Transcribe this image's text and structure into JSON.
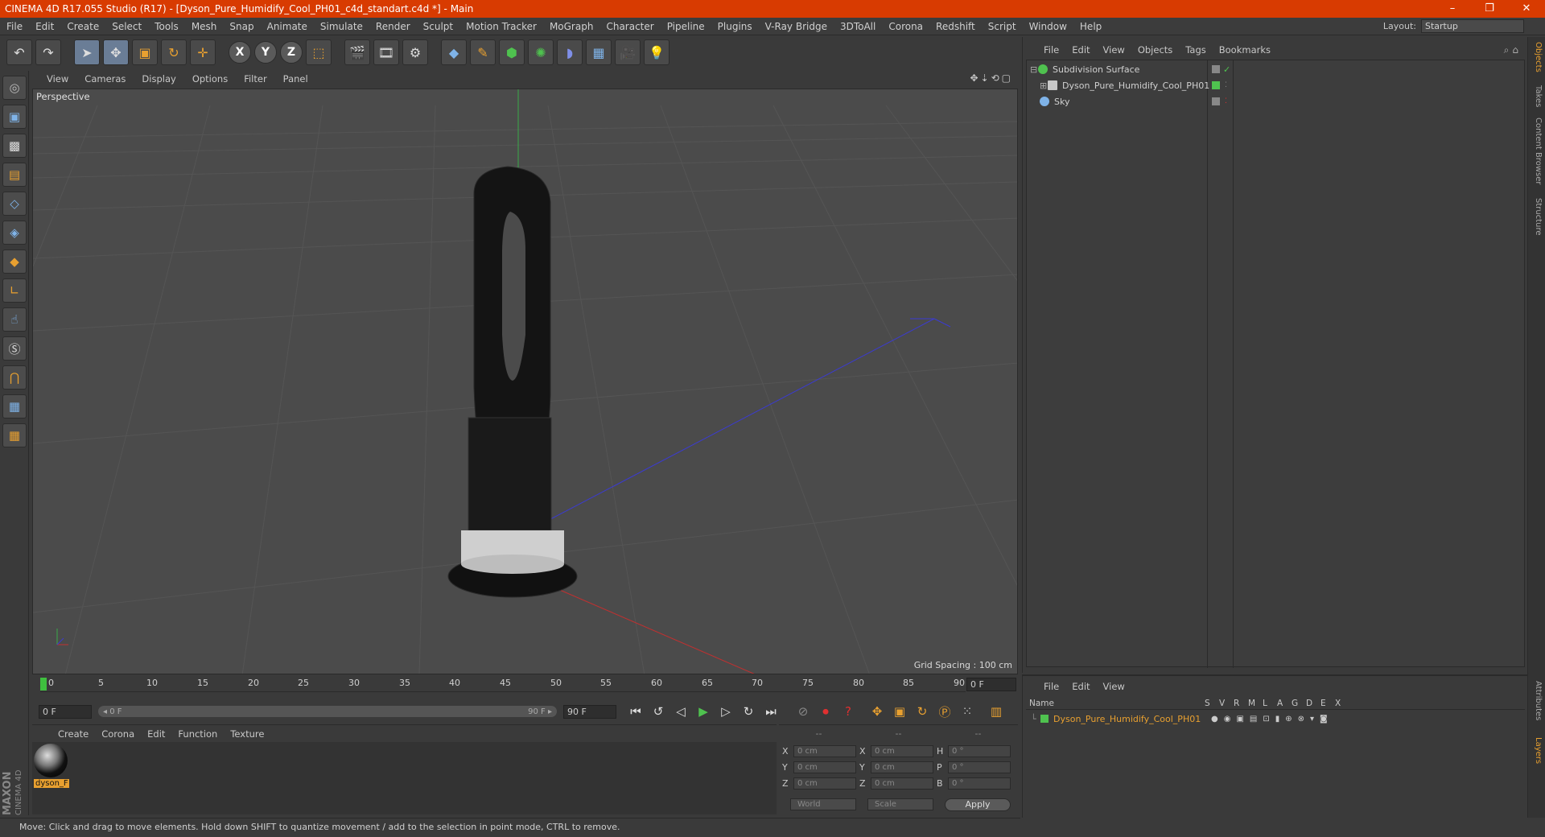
{
  "app": {
    "title": "CINEMA 4D R17.055 Studio (R17) - [Dyson_Pure_Humidify_Cool_PH01_c4d_standart.c4d *] - Main",
    "window_buttons": [
      "–",
      "❐",
      "✕"
    ]
  },
  "menubar": {
    "items": [
      "File",
      "Edit",
      "Create",
      "Select",
      "Tools",
      "Mesh",
      "Snap",
      "Animate",
      "Simulate",
      "Render",
      "Sculpt",
      "Motion Tracker",
      "MoGraph",
      "Character",
      "Pipeline",
      "Plugins",
      "V-Ray Bridge",
      "3DToAll",
      "Corona",
      "Redshift",
      "Script",
      "Window",
      "Help"
    ],
    "layout_label": "Layout:",
    "layout_value": "Startup"
  },
  "viewport": {
    "menu": [
      "View",
      "Cameras",
      "Display",
      "Options",
      "Filter",
      "Panel"
    ],
    "label": "Perspective",
    "grid_spacing": "Grid Spacing : 100 cm"
  },
  "timeline": {
    "ticks": [
      "0",
      "5",
      "10",
      "15",
      "20",
      "25",
      "30",
      "35",
      "40",
      "45",
      "50",
      "55",
      "60",
      "65",
      "70",
      "75",
      "80",
      "85",
      "90"
    ],
    "current_frame": "0 F",
    "start_field": "0 F",
    "range_start": "◂ 0 F",
    "range_end": "90 F ▸",
    "end_field": "90 F"
  },
  "materials": {
    "menu": [
      "Create",
      "Corona",
      "Edit",
      "Function",
      "Texture"
    ],
    "items": [
      {
        "label": "dyson_F"
      }
    ]
  },
  "coordinates": {
    "headers": [
      "--",
      "--",
      "--"
    ],
    "rows": [
      {
        "a": "X",
        "av": "0 cm",
        "b": "X",
        "bv": "0 cm",
        "c": "H",
        "cv": "0 °"
      },
      {
        "a": "Y",
        "av": "0 cm",
        "b": "Y",
        "bv": "0 cm",
        "c": "P",
        "cv": "0 °"
      },
      {
        "a": "Z",
        "av": "0 cm",
        "b": "Z",
        "bv": "0 cm",
        "c": "B",
        "cv": "0 °"
      }
    ],
    "mode": "World",
    "scale": "Scale",
    "apply": "Apply"
  },
  "objects": {
    "menu": [
      "File",
      "Edit",
      "View",
      "Objects",
      "Tags",
      "Bookmarks"
    ],
    "tree": [
      {
        "name": "Subdivision Surface",
        "icon_color": "#4fc24f"
      },
      {
        "name": "Dyson_Pure_Humidify_Cool_PH01",
        "icon_color": "#c8c8c8"
      },
      {
        "name": "Sky",
        "icon_color": "#7fb3e8"
      }
    ]
  },
  "layers": {
    "menu": [
      "File",
      "Edit",
      "View"
    ],
    "columns": [
      "Name",
      "S",
      "V",
      "R",
      "M",
      "L",
      "A",
      "G",
      "D",
      "E",
      "X"
    ],
    "rows": [
      {
        "name": "Dyson_Pure_Humidify_Cool_PH01",
        "color": "#4fc24f"
      }
    ]
  },
  "side_tabs": [
    "Objects",
    "Takes",
    "Content Browser",
    "Structure",
    "Attributes",
    "Layers"
  ],
  "status": "Move: Click and drag to move elements. Hold down SHIFT to quantize movement / add to the selection in point mode, CTRL to remove.",
  "logo": {
    "line1": "MAXON",
    "line2": "CINEMA 4D"
  }
}
